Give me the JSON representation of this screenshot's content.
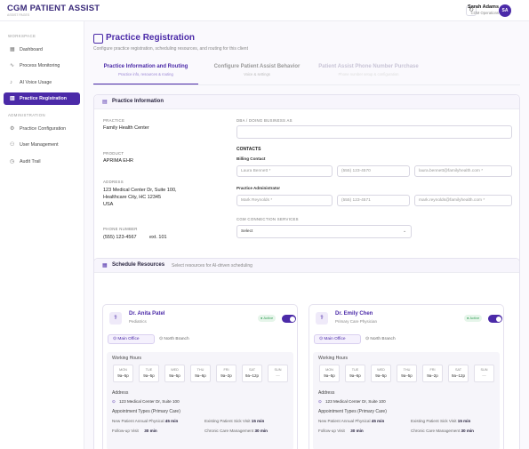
{
  "app": {
    "brand": "CGM PATIENT ASSIST",
    "brand_sub": "ASSIST PAGES"
  },
  "user": {
    "name": "Sarah Adams",
    "role": "CGM Operations",
    "initials": "SA"
  },
  "sidebar": {
    "workspace_label": "WORKSPACE",
    "admin_label": "ADMINISTRATION",
    "items": [
      {
        "label": "Dashboard",
        "icon": "grid-icon"
      },
      {
        "label": "Process Monitoring",
        "icon": "pulse-icon"
      },
      {
        "label": "AI Voice Usage",
        "icon": "mic-icon"
      },
      {
        "label": "Practice Registration",
        "icon": "building-icon"
      },
      {
        "label": "Practice Configuration",
        "icon": "wrench-icon"
      },
      {
        "label": "User Management",
        "icon": "users-icon"
      },
      {
        "label": "Audit Trail",
        "icon": "clock-icon"
      }
    ]
  },
  "page": {
    "title": "Practice Registration",
    "subtitle": "Configure practice registration, scheduling resources, and routing for this client"
  },
  "tabs": [
    {
      "label": "Practice Information and Routing",
      "sub": "Practice info, resources & routing"
    },
    {
      "label": "Configure Patient Assist Behavior",
      "sub": "Voice & settings"
    },
    {
      "label": "Patient Assist Phone Number Purchase",
      "sub": "Phone number setup & configuration"
    }
  ],
  "practice": {
    "section_title": "Practice Information",
    "practice_label": "PRACTICE",
    "practice_value": "Family Health Center",
    "product_label": "PRODUCT",
    "product_value": "APRIMA EHR",
    "address_label": "ADDRESS",
    "address_lines": [
      "123 Medical Center Dr, Suite 100,",
      "Healthcare City, HC 12345",
      "USA"
    ],
    "phone_label": "PHONE NUMBER",
    "phone_value": "(555) 123-4567",
    "phone_ext": "ext. 101",
    "dba_label": "DBA / DOING BUSINESS AS",
    "dba_value": "",
    "contacts_label": "CONTACTS",
    "billing_label": "Billing Contact",
    "billing": {
      "name": "Laura Bennett *",
      "phone": "(555) 123-4570",
      "email": "laura.bennett@familyhealth.com *"
    },
    "admin_label": "Practice Administrator",
    "admin": {
      "name": "Mark Reynolds *",
      "phone": "(555) 123-4571",
      "email": "mark.reynolds@familyhealth.com *"
    },
    "connection_label": "CGM CONNECTION SERVICES",
    "connection_value": "Select"
  },
  "schedule": {
    "title": "Schedule Resources",
    "desc": "Select resources for AI-driven scheduling",
    "providers": [
      {
        "name": "Dr. Anita Patel",
        "specialty": "Pediatrics",
        "status": "Active",
        "tab_main": "Main Office",
        "tab_north": "North Branch",
        "hours_label": "Working Hours",
        "days": [
          {
            "d": "MON",
            "h": "9a–5p"
          },
          {
            "d": "TUE",
            "h": "9a–5p"
          },
          {
            "d": "WED",
            "h": "9a–5p"
          },
          {
            "d": "THU",
            "h": "9a–6p"
          },
          {
            "d": "FRI",
            "h": "9a–2p"
          },
          {
            "d": "SAT",
            "h": "9a–12p"
          },
          {
            "d": "SUN",
            "h": "—"
          }
        ],
        "address_label": "Address",
        "address": "123 Medical Center Dr, Suite 100",
        "appt_label": "Appointment Types (Primary Care)",
        "appts": [
          {
            "name": "New Patient Annual Physical",
            "dur": "45 min"
          },
          {
            "name": "Existing Patient Sick Visit",
            "dur": "15 min"
          },
          {
            "name": "Follow-up Visit",
            "dur": "30 min"
          },
          {
            "name": "Chronic Care Management",
            "dur": "30 min"
          }
        ]
      },
      {
        "name": "Dr. Emily Chen",
        "specialty": "Primary Care Physician",
        "status": "Active",
        "tab_main": "Main Office",
        "tab_north": "North Branch",
        "hours_label": "Working Hours",
        "days": [
          {
            "d": "MON",
            "h": "9a–5p"
          },
          {
            "d": "TUE",
            "h": "9a–6p"
          },
          {
            "d": "WED",
            "h": "9a–5p"
          },
          {
            "d": "THU",
            "h": "9a–5p"
          },
          {
            "d": "FRI",
            "h": "9a–2p"
          },
          {
            "d": "SAT",
            "h": "9a–12p"
          },
          {
            "d": "SUN",
            "h": "—"
          }
        ],
        "address_label": "Address",
        "address": "123 Medical Center Dr, Suite 100",
        "appt_label": "Appointment Types (Primary Care)",
        "appts": [
          {
            "name": "New Patient Annual Physical",
            "dur": "45 min"
          },
          {
            "name": "Existing Patient Sick Visit",
            "dur": "15 min"
          },
          {
            "name": "Follow-up Visit",
            "dur": "30 min"
          },
          {
            "name": "Chronic Care Management",
            "dur": "30 min"
          }
        ]
      }
    ]
  },
  "colors": {
    "accent": "#4b2aa8",
    "active_badge": "#3aa35c"
  }
}
